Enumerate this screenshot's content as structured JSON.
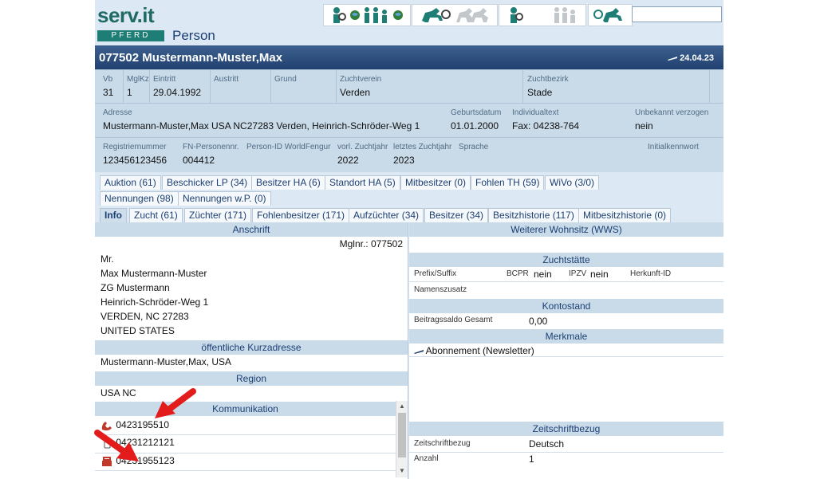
{
  "header": {
    "logo_text": "serv.it",
    "logo_sub": "PFERD",
    "page_title": "Person"
  },
  "record": {
    "id_name": "077502  Mustermann-Muster,Max",
    "date": "24.04.23"
  },
  "grid1": [
    {
      "label": "Vb",
      "value": "31"
    },
    {
      "label": "MglKz",
      "value": "1"
    },
    {
      "label": "Eintritt",
      "value": "29.04.1992"
    },
    {
      "label": "Austritt",
      "value": ""
    },
    {
      "label": "Grund",
      "value": ""
    },
    {
      "label": "Zuchtverein",
      "value": "Verden"
    },
    {
      "label": "Zuchtbezirk",
      "value": "Stade"
    }
  ],
  "grid2": [
    {
      "label": "Adresse",
      "value": "Mustermann-Muster,Max USA NC27283 Verden, Heinrich-Schröder-Weg 1"
    },
    {
      "label": "Geburtsdatum",
      "value": "01.01.2000"
    },
    {
      "label": "Individualtext",
      "value": "Fax: 04238-764"
    },
    {
      "label": "Unbekannt verzogen",
      "value": "nein"
    }
  ],
  "grid3": [
    {
      "label": "Registriernummer",
      "value": "123456123456"
    },
    {
      "label": "FN-Personennr.",
      "value": "004412"
    },
    {
      "label": "Person-ID WorldFengur",
      "value": ""
    },
    {
      "label": "vorl. Zuchtjahr",
      "value": "2022"
    },
    {
      "label": "letztes Zuchtjahr",
      "value": "2023"
    },
    {
      "label": "Sprache",
      "value": ""
    },
    {
      "label": "Initialkennwort",
      "value": ""
    }
  ],
  "tabs_row1": [
    "Auktion (61)",
    "Beschicker LP (34)",
    "Besitzer HA (6)",
    "Standort HA (5)",
    "Mitbesitzer (0)",
    "Fohlen TH (59)",
    "WiVo (3/0)"
  ],
  "tabs_row2": [
    "Nennungen (98)",
    "Nennungen w.P. (0)"
  ],
  "tabs_row3": [
    "Info",
    "Zucht (61)",
    "Züchter (171)",
    "Fohlenbesitzer (171)",
    "Aufzüchter (34)",
    "Besitzer (34)",
    "Besitzhistorie (117)",
    "Mitbesitzhistorie (0)"
  ],
  "anschrift": {
    "title": "Anschrift",
    "mglnr": "Mglnr.: 077502",
    "lines": [
      "Mr.",
      "Max Mustermann-Muster",
      "ZG Mustermann",
      "Heinrich-Schröder-Weg 1",
      "VERDEN, NC  27283",
      "UNITED STATES"
    ]
  },
  "kurzadresse": {
    "title": "öffentliche Kurzadresse",
    "value": "Mustermann-Muster,Max, USA"
  },
  "region": {
    "title": "Region",
    "value": "USA NC"
  },
  "kommunikation": {
    "title": "Kommunikation",
    "items": [
      {
        "icon": "phone-icon",
        "value": "0423195510"
      },
      {
        "icon": "mobile-icon",
        "value": "04231212121"
      },
      {
        "icon": "fax-icon",
        "value": "04231955123"
      }
    ]
  },
  "wws": {
    "title": "Weiterer Wohnsitz (WWS)"
  },
  "zuchtstaette": {
    "title": "Zuchtstätte",
    "prefix_label": "Prefix/Suffix",
    "bcpr_label": "BCPR",
    "bcpr_value": "nein",
    "ipzv_label": "IPZV",
    "ipzv_value": "nein",
    "herkunft_label": "Herkunft-ID",
    "namenszusatz_label": "Namenszusatz"
  },
  "kontostand": {
    "title": "Kontostand",
    "label": "Beitragssaldo Gesamt",
    "value": "0,00"
  },
  "merkmale": {
    "title": "Merkmale",
    "items": [
      "Abonnement (Newsletter)"
    ]
  },
  "zeitschrift": {
    "title": "Zeitschriftbezug",
    "rows": [
      {
        "label": "Zeitschriftbezug",
        "value": "Deutsch"
      },
      {
        "label": "Anzahl",
        "value": "1"
      }
    ]
  },
  "colors": {
    "accent": "#21426f",
    "header_bg": "#dce9f5",
    "section_bg": "#c9dbe9",
    "arrow": "#e31b1b"
  }
}
